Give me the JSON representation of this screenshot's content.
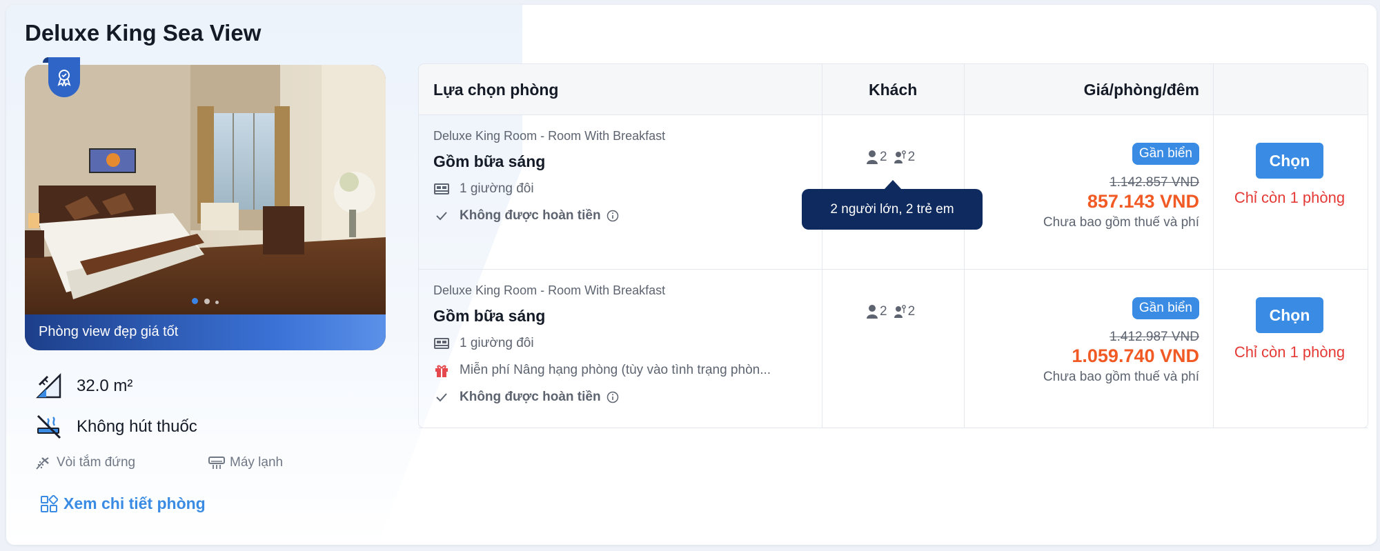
{
  "room": {
    "name": "Deluxe King Sea View",
    "photo_caption": "Phòng view đẹp giá tốt",
    "photo_index": 1,
    "photo_count": 3,
    "features": [
      {
        "icon": "area-ruler-icon",
        "label": "32.0 m²"
      },
      {
        "icon": "no-smoking-icon",
        "label": "Không hút thuốc"
      }
    ],
    "amenities": [
      {
        "icon": "shower-icon",
        "label": "Vòi tắm đứng"
      },
      {
        "icon": "air-conditioner-icon",
        "label": "Máy lạnh"
      }
    ],
    "detail_link": "Xem chi tiết phòng"
  },
  "table": {
    "headers": {
      "option": "Lựa chọn phòng",
      "guests": "Khách",
      "price": "Giá/phòng/đêm",
      "action": ""
    },
    "tooltip": "2 người lớn, 2 trẻ em",
    "rows": [
      {
        "subtitle": "Deluxe King Room - Room With Breakfast",
        "title": "Gồm bữa sáng",
        "bed": "1 giường đôi",
        "gift": "",
        "refund": "Không được hoàn tiền",
        "adults": "2",
        "children": "2",
        "tag": "Gần biển",
        "old_price": "1.142.857 VND",
        "price": "857.143 VND",
        "tax_note": "Chưa bao gồm thuế và phí",
        "button": "Chọn",
        "remaining": "Chỉ còn 1 phòng"
      },
      {
        "subtitle": "Deluxe King Room - Room With Breakfast",
        "title": "Gồm bữa sáng",
        "bed": "1 giường đôi",
        "gift": "Miễn phí Nâng hạng phòng (tùy vào tình trạng phòn...",
        "refund": "Không được hoàn tiền",
        "adults": "2",
        "children": "2",
        "tag": "Gần biển",
        "old_price": "1.412.987 VND",
        "price": "1.059.740 VND",
        "tax_note": "Chưa bao gồm thuế và phí",
        "button": "Chọn",
        "remaining": "Chỉ còn 1 phòng"
      }
    ]
  },
  "colors": {
    "accent": "#3a8be3",
    "price": "#f15a24",
    "warning": "#e53935",
    "tooltip": "#0f2a5e"
  }
}
